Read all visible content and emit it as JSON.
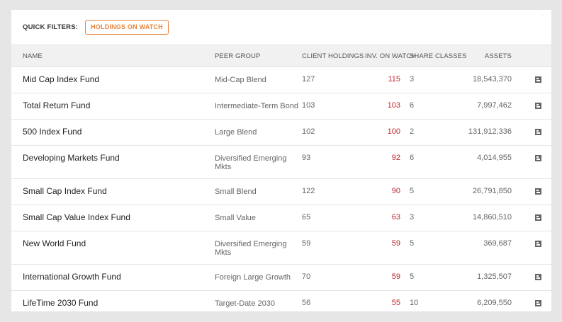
{
  "filters": {
    "label": "QUICK FILTERS:",
    "chip": "HOLDINGS ON WATCH",
    "accent": "#e8833a"
  },
  "table": {
    "headers": {
      "name": "NAME",
      "peer": "PEER GROUP",
      "holdings": "CLIENT HOLDINGS",
      "watch": "INV. ON WATCH",
      "share": "SHARE CLASSES",
      "assets": "ASSETS"
    },
    "watch_color": "#c0282f",
    "rows": [
      {
        "name": "Mid Cap Index Fund",
        "peer": "Mid-Cap Blend",
        "holdings": "127",
        "watch": "115",
        "share": "3",
        "assets": "18,543,370",
        "icon": "report-icon"
      },
      {
        "name": "Total Return Fund",
        "peer": "Intermediate-Term Bond",
        "holdings": "103",
        "watch": "103",
        "share": "6",
        "assets": "7,997,462",
        "icon": "report-icon"
      },
      {
        "name": "500 Index Fund",
        "peer": "Large Blend",
        "holdings": "102",
        "watch": "100",
        "share": "2",
        "assets": "131,912,336",
        "icon": "report-icon"
      },
      {
        "name": "Developing Markets Fund",
        "peer": "Diversified Emerging Mkts",
        "holdings": "93",
        "watch": "92",
        "share": "6",
        "assets": "4,014,955",
        "icon": "report-icon"
      },
      {
        "name": "Small Cap Index Fund",
        "peer": "Small Blend",
        "holdings": "122",
        "watch": "90",
        "share": "5",
        "assets": "26,791,850",
        "icon": "report-icon"
      },
      {
        "name": "Small Cap Value Index Fund",
        "peer": "Small Value",
        "holdings": "65",
        "watch": "63",
        "share": "3",
        "assets": "14,860,510",
        "icon": "report-icon"
      },
      {
        "name": "New World Fund",
        "peer": "Diversified Emerging Mkts",
        "holdings": "59",
        "watch": "59",
        "share": "5",
        "assets": "369,687",
        "icon": "report-icon"
      },
      {
        "name": "International Growth Fund",
        "peer": "Foreign Large Growth",
        "holdings": "70",
        "watch": "59",
        "share": "5",
        "assets": "1,325,507",
        "icon": "report-icon"
      },
      {
        "name": "LifeTime 2030 Fund",
        "peer": "Target-Date 2030",
        "holdings": "56",
        "watch": "55",
        "share": "10",
        "assets": "6,209,550",
        "icon": "report-icon"
      }
    ]
  }
}
